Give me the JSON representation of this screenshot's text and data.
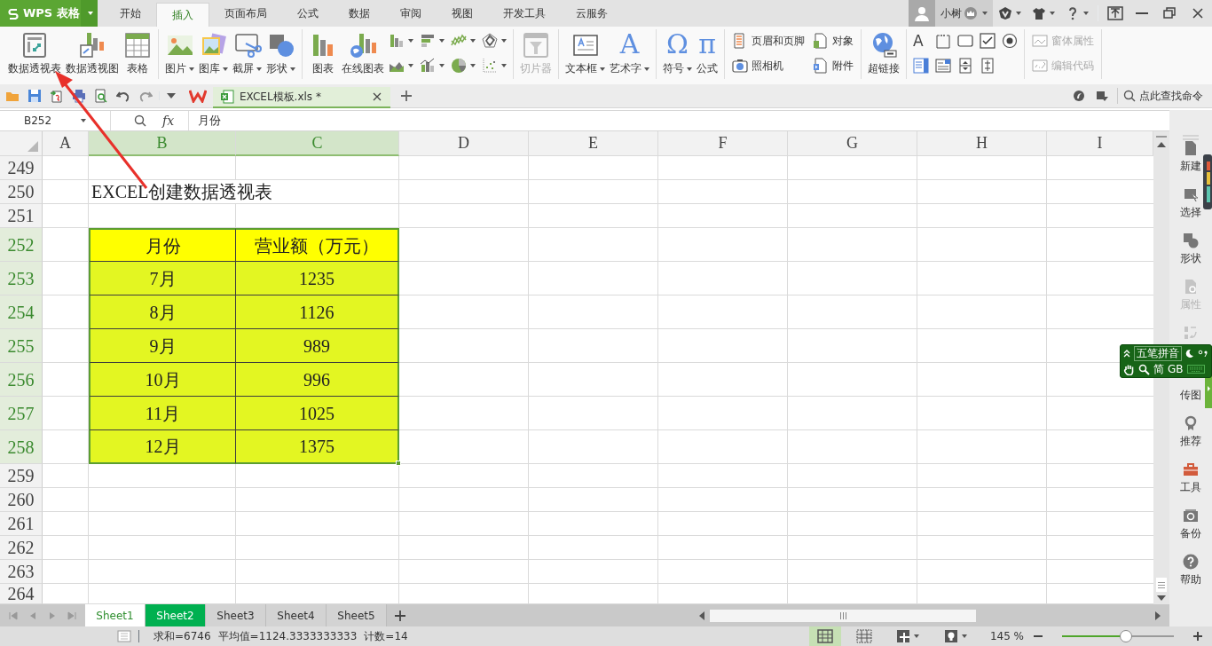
{
  "app": {
    "logo": "WPS 表格"
  },
  "menu_tabs": [
    {
      "label": "开始",
      "selected": false
    },
    {
      "label": "插入",
      "selected": true
    },
    {
      "label": "页面布局",
      "selected": false
    },
    {
      "label": "公式",
      "selected": false
    },
    {
      "label": "数据",
      "selected": false
    },
    {
      "label": "审阅",
      "selected": false
    },
    {
      "label": "视图",
      "selected": false
    },
    {
      "label": "开发工具",
      "selected": false
    },
    {
      "label": "云服务",
      "selected": false
    }
  ],
  "user": {
    "name": "小树"
  },
  "ribbon": [
    {
      "items": [
        {
          "kind": "large",
          "label": "数据透视表",
          "dropdown": false,
          "disabled": false
        },
        {
          "kind": "large",
          "label": "数据透视图",
          "dropdown": false,
          "disabled": false
        },
        {
          "kind": "large",
          "label": "表格",
          "dropdown": false,
          "disabled": false
        }
      ]
    },
    {
      "items": [
        {
          "kind": "large",
          "label": "图片",
          "dropdown": true,
          "disabled": false
        },
        {
          "kind": "large",
          "label": "图库",
          "dropdown": true,
          "disabled": false
        },
        {
          "kind": "large",
          "label": "截屏",
          "dropdown": true,
          "disabled": false
        },
        {
          "kind": "large",
          "label": "形状",
          "dropdown": true,
          "disabled": false
        }
      ]
    },
    {
      "items": [
        {
          "kind": "large",
          "label": "图表",
          "dropdown": false,
          "disabled": false
        },
        {
          "kind": "large",
          "label": "在线图表",
          "dropdown": false,
          "disabled": false
        },
        {
          "kind": "icon",
          "dropdown": true,
          "disabled": false
        },
        {
          "kind": "icon",
          "dropdown": true,
          "disabled": false
        },
        {
          "kind": "icon",
          "dropdown": true,
          "disabled": false
        },
        {
          "kind": "icon",
          "dropdown": true,
          "disabled": false
        },
        {
          "kind": "icon",
          "dropdown": true,
          "disabled": false
        },
        {
          "kind": "icon",
          "dropdown": true,
          "disabled": false
        },
        {
          "kind": "icon",
          "dropdown": true,
          "disabled": false
        },
        {
          "kind": "icon",
          "dropdown": true,
          "disabled": false
        }
      ]
    },
    {
      "items": [
        {
          "kind": "large",
          "label": "切片器",
          "dropdown": false,
          "disabled": true
        }
      ]
    },
    {
      "items": [
        {
          "kind": "large",
          "label": "文本框",
          "dropdown": true,
          "disabled": false
        },
        {
          "kind": "large",
          "label": "艺术字",
          "glyph": "A",
          "dropdown": true,
          "disabled": false
        }
      ]
    },
    {
      "items": [
        {
          "kind": "large",
          "label": "符号",
          "glyph": "Ω",
          "dropdown": true,
          "disabled": false
        },
        {
          "kind": "large",
          "label": "公式",
          "glyph": "π",
          "dropdown": false,
          "disabled": false
        }
      ]
    },
    {
      "items": [
        {
          "kind": "small",
          "label": "页眉和页脚",
          "dropdown": false,
          "disabled": false
        },
        {
          "kind": "small",
          "label": "照相机",
          "dropdown": false,
          "disabled": false
        },
        {
          "kind": "small",
          "label": "对象",
          "dropdown": false,
          "disabled": false
        },
        {
          "kind": "small",
          "label": "附件",
          "dropdown": false,
          "disabled": false
        }
      ]
    },
    {
      "items": [
        {
          "kind": "large",
          "label": "超链接",
          "dropdown": false,
          "disabled": false
        }
      ]
    },
    {
      "items": [
        {
          "kind": "icon",
          "glyph": "A",
          "dropdown": false,
          "disabled": false
        },
        {
          "kind": "icon",
          "dropdown": false,
          "disabled": false
        },
        {
          "kind": "icon",
          "dropdown": false,
          "disabled": false
        },
        {
          "kind": "icon",
          "dropdown": false,
          "disabled": false
        },
        {
          "kind": "icon",
          "dropdown": false,
          "disabled": false
        },
        {
          "kind": "icon",
          "dropdown": false,
          "disabled": false
        },
        {
          "kind": "icon",
          "dropdown": false,
          "disabled": false
        },
        {
          "kind": "icon",
          "dropdown": false,
          "disabled": false
        },
        {
          "kind": "icon",
          "dropdown": false,
          "disabled": false
        }
      ]
    },
    {
      "items": [
        {
          "kind": "small",
          "label": "窗体属性",
          "dropdown": false,
          "disabled": true
        },
        {
          "kind": "small",
          "label": "编辑代码",
          "dropdown": false,
          "disabled": true
        }
      ]
    }
  ],
  "quick_access": {
    "document_tab": {
      "title": "EXCEL模板.xls *",
      "selected": true
    },
    "search_label": "点此查找命令"
  },
  "formula_bar": {
    "name_box": "B252",
    "function_label": "fx",
    "content": "月份"
  },
  "sheet": {
    "columns": [
      {
        "label": "A",
        "selected": false
      },
      {
        "label": "B",
        "selected": true
      },
      {
        "label": "C",
        "selected": true
      },
      {
        "label": "D",
        "selected": false
      },
      {
        "label": "E",
        "selected": false
      },
      {
        "label": "F",
        "selected": false
      },
      {
        "label": "G",
        "selected": false
      },
      {
        "label": "H",
        "selected": false
      },
      {
        "label": "I",
        "selected": false
      }
    ],
    "rows": [
      {
        "number": "249",
        "kind": "empty",
        "selected": false
      },
      {
        "number": "250",
        "kind": "title",
        "selected": false,
        "cells": [
          "EXCEL创建数据透视表"
        ]
      },
      {
        "number": "251",
        "kind": "empty",
        "selected": false
      },
      {
        "number": "252",
        "kind": "table-header",
        "selected": true,
        "cells": [
          "月份",
          "营业额（万元）"
        ]
      },
      {
        "number": "253",
        "kind": "table-row",
        "selected": true,
        "cells": [
          "7月",
          "1235"
        ]
      },
      {
        "number": "254",
        "kind": "table-row",
        "selected": true,
        "cells": [
          "8月",
          "1126"
        ]
      },
      {
        "number": "255",
        "kind": "table-row",
        "selected": true,
        "cells": [
          "9月",
          "989"
        ]
      },
      {
        "number": "256",
        "kind": "table-row",
        "selected": true,
        "cells": [
          "10月",
          "996"
        ]
      },
      {
        "number": "257",
        "kind": "table-row",
        "selected": true,
        "cells": [
          "11月",
          "1025"
        ]
      },
      {
        "number": "258",
        "kind": "table-row",
        "selected": true,
        "cells": [
          "12月",
          "1375"
        ]
      },
      {
        "number": "259",
        "kind": "empty",
        "selected": false
      },
      {
        "number": "260",
        "kind": "empty",
        "selected": false
      },
      {
        "number": "261",
        "kind": "empty",
        "selected": false
      },
      {
        "number": "262",
        "kind": "empty",
        "selected": false
      },
      {
        "number": "263",
        "kind": "empty",
        "selected": false
      },
      {
        "number": "264",
        "kind": "empty",
        "selected": false
      }
    ]
  },
  "sheet_tabs": [
    {
      "label": "Sheet1",
      "selected": true
    },
    {
      "label": "Sheet2",
      "selected": false,
      "color": "#00b050"
    },
    {
      "label": "Sheet3",
      "selected": false
    },
    {
      "label": "Sheet4",
      "selected": false
    },
    {
      "label": "Sheet5",
      "selected": false
    }
  ],
  "status_bar": {
    "sum": "求和=6746",
    "average": "平均值=1124.3333333333",
    "count": "计数=14",
    "view_modes": [
      {
        "selected": true
      },
      {
        "selected": false
      }
    ],
    "zoom": {
      "reading": "145 %",
      "level": 0.57
    }
  },
  "sidebar": [
    {
      "label": "新建",
      "disabled": false
    },
    {
      "label": "选择",
      "disabled": false
    },
    {
      "label": "形状",
      "disabled": false
    },
    {
      "label": "属性",
      "disabled": true
    },
    {
      "disabled": true
    },
    {
      "label": "传图",
      "disabled": false
    },
    {
      "label": "推荐",
      "disabled": false
    },
    {
      "label": "工具",
      "disabled": false
    },
    {
      "label": "备份",
      "disabled": false
    },
    {
      "label": "帮助",
      "disabled": false
    }
  ],
  "ime": {
    "mode": "五笔拼音",
    "script": "简",
    "encoding": "GB"
  }
}
